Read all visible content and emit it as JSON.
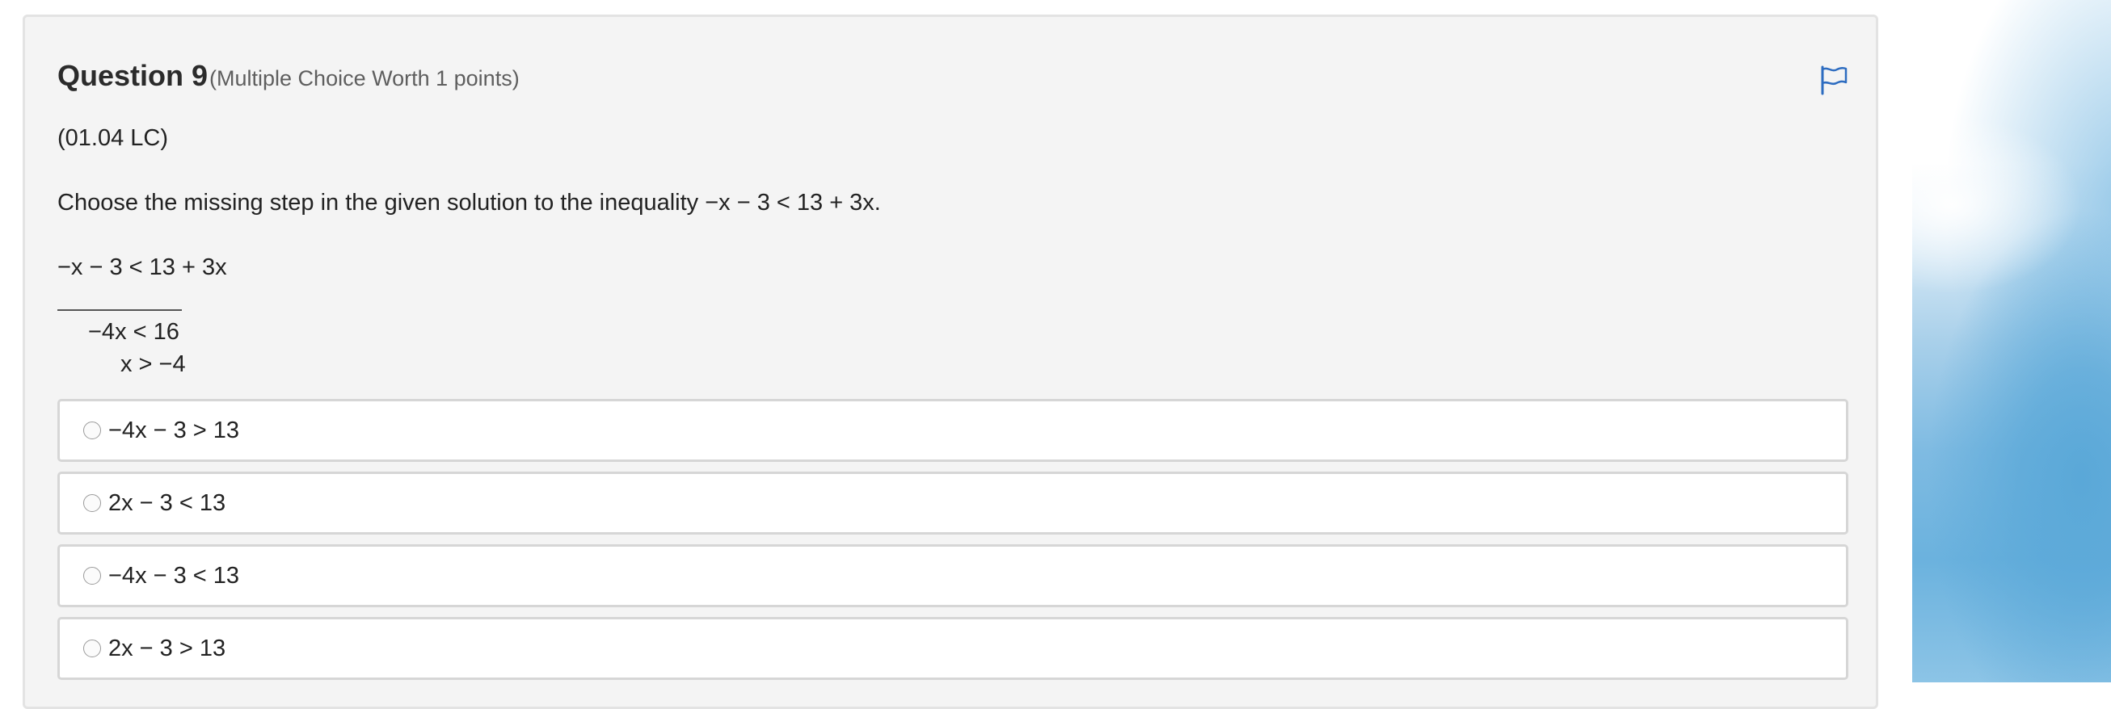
{
  "question": {
    "title": "Question 9",
    "meta": "(Multiple Choice Worth 1 points)",
    "code": "(01.04 LC)",
    "prompt": "Choose the missing step in the given solution to the inequality −x − 3 < 13 + 3x.",
    "flag_icon": "flag-icon",
    "accent_color": "#2d6cc0"
  },
  "solution": {
    "step1": "−x − 3 < 13 + 3x",
    "step3": "−4x < 16",
    "step4": "x > −4"
  },
  "options": [
    {
      "label": "−4x − 3 > 13",
      "selected": false
    },
    {
      "label": "2x − 3 < 13",
      "selected": false
    },
    {
      "label": "−4x − 3 < 13",
      "selected": false
    },
    {
      "label": "2x − 3 > 13",
      "selected": false
    }
  ]
}
